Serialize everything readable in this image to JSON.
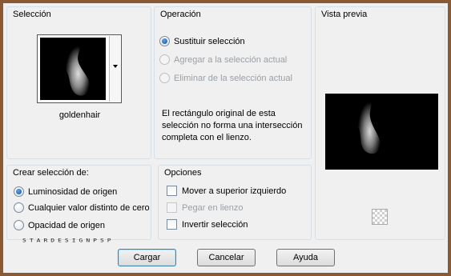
{
  "seleccion": {
    "title": "Selección",
    "source_name": "goldenhair"
  },
  "operacion": {
    "title": "Operación",
    "options": [
      {
        "label": "Sustituir selección",
        "checked": true,
        "enabled": true
      },
      {
        "label": "Agregar a la selección actual",
        "checked": false,
        "enabled": false
      },
      {
        "label": "Eliminar de la selección actual",
        "checked": false,
        "enabled": false
      }
    ],
    "info_text": "El rectángulo original de esta selección no forma una intersección completa con el lienzo."
  },
  "vista_previa": {
    "title": "Vista previa",
    "checker_icon": "transparency-checker-icon"
  },
  "crear": {
    "title": "Crear selección de:",
    "options": [
      {
        "label": "Luminosidad de origen",
        "checked": true
      },
      {
        "label": "Cualquier valor distinto de cero",
        "checked": false
      },
      {
        "label": "Opacidad de origen",
        "checked": false
      }
    ]
  },
  "opciones": {
    "title": "Opciones",
    "items": [
      {
        "label": "Mover a superior izquierdo",
        "checked": false,
        "enabled": true
      },
      {
        "label": "Pegar en lienzo",
        "checked": false,
        "enabled": false
      },
      {
        "label": "Invertir selección",
        "checked": false,
        "enabled": true
      }
    ]
  },
  "watermark": "STARDESIGNPSP",
  "buttons": {
    "load": "Cargar",
    "cancel": "Cancelar",
    "help": "Ayuda"
  },
  "colors": {
    "frame": "#8a5a34",
    "dialog_bg": "#f0f0f0",
    "group_border": "#d5dfe5",
    "default_button_border": "#3c7fb1"
  }
}
